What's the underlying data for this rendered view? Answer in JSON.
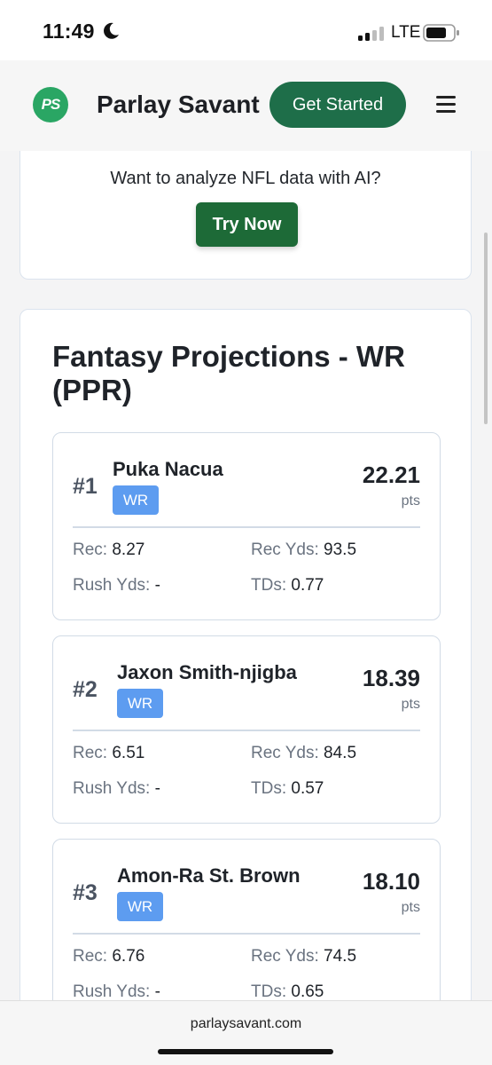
{
  "status_bar": {
    "time": "11:49",
    "network": "LTE"
  },
  "header": {
    "logo_text": "PS",
    "brand": "Parlay Savant",
    "cta_label": "Get Started"
  },
  "promo": {
    "text": "Want to analyze NFL data with AI?",
    "button_label": "Try Now"
  },
  "projections": {
    "title": "Fantasy Projections - WR (PPR)",
    "players": [
      {
        "rank": "#1",
        "name": "Puka Nacua",
        "position": "WR",
        "points": "22.21",
        "points_label": "pts",
        "rec_label": "Rec:",
        "rec": "8.27",
        "rec_yds_label": "Rec Yds:",
        "rec_yds": "93.5",
        "rush_yds_label": "Rush Yds:",
        "rush_yds": "-",
        "tds_label": "TDs:",
        "tds": "0.77"
      },
      {
        "rank": "#2",
        "name": "Jaxon Smith-njigba",
        "position": "WR",
        "points": "18.39",
        "points_label": "pts",
        "rec_label": "Rec:",
        "rec": "6.51",
        "rec_yds_label": "Rec Yds:",
        "rec_yds": "84.5",
        "rush_yds_label": "Rush Yds:",
        "rush_yds": "-",
        "tds_label": "TDs:",
        "tds": "0.57"
      },
      {
        "rank": "#3",
        "name": "Amon-Ra St. Brown",
        "position": "WR",
        "points": "18.10",
        "points_label": "pts",
        "rec_label": "Rec:",
        "rec": "6.76",
        "rec_yds_label": "Rec Yds:",
        "rec_yds": "74.5",
        "rush_yds_label": "Rush Yds:",
        "rush_yds": "-",
        "tds_label": "TDs:",
        "tds": "0.65"
      }
    ]
  },
  "footer": {
    "url": "parlaysavant.com"
  },
  "colors": {
    "brand_green": "#1e6e49",
    "try_green": "#1d6a37",
    "logo_green": "#2aa664",
    "position_badge": "#5d9cf0"
  },
  "icons": [
    "moon-icon",
    "signal-icon",
    "battery-icon",
    "menu-icon"
  ]
}
